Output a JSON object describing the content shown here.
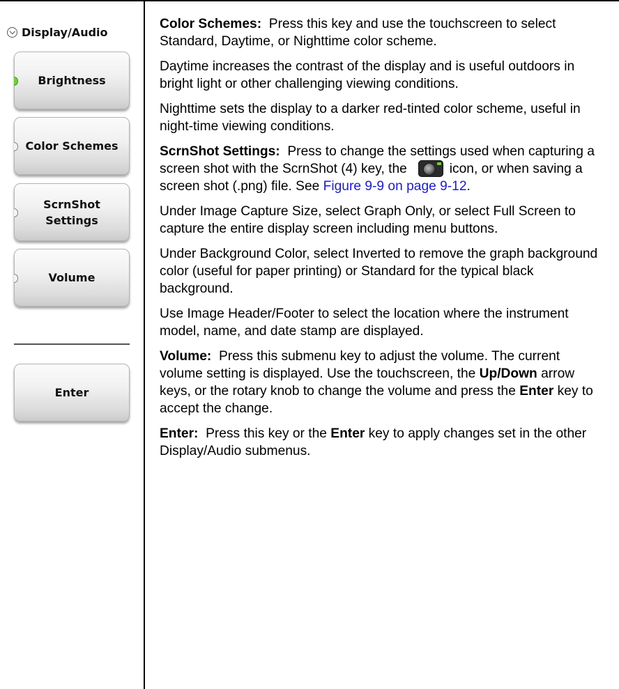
{
  "menu": {
    "title": "Display/Audio",
    "buttons": [
      {
        "label": "Brightness",
        "active": true
      },
      {
        "label": "Color Schemes",
        "active": false
      },
      {
        "label": "ScrnShot Settings",
        "active": false
      },
      {
        "label": "Volume",
        "active": false
      }
    ],
    "enter_label": "Enter"
  },
  "content": {
    "p1_term": "Color Schemes:",
    "p1_text": "Press this key and use the touchscreen to select Standard, Daytime, or Nighttime color scheme.",
    "p2": "Daytime increases the contrast of the display and is useful outdoors in bright light or other challenging viewing conditions.",
    "p3": "Nighttime sets the display to a darker red-tinted color scheme, useful in night-time viewing conditions.",
    "p4_term": "ScrnShot Settings:",
    "p4_text_a": "Press to change the settings used when capturing a screen shot with the ScrnShot (4) key, the",
    "p4_text_b": "icon, or when saving a screen shot (.png) file. See",
    "p4_link": "Figure 9-9 on page 9-12",
    "p4_end": ".",
    "p5": "Under Image Capture Size, select Graph Only, or select Full Screen to capture the entire display screen including menu buttons.",
    "p6": "Under Background Color, select Inverted to remove the graph background color (useful for paper printing) or Standard for the typical black background.",
    "p7": "Use Image Header/Footer to select the location where the instrument model, name, and date stamp are displayed.",
    "p8_term": "Volume:",
    "p8_text_a": "Press this submenu key to adjust the volume. The current volume setting is displayed. Use the touchscreen, the",
    "p8_bold_a": "Up/Down",
    "p8_text_b": "arrow keys, or the rotary knob to change the volume and press the",
    "p8_bold_b": "Enter",
    "p8_text_c": "key to accept the change.",
    "p9_term": "Enter:",
    "p9_text_a": "Press this key or the",
    "p9_bold": "Enter",
    "p9_text_b": "key to apply changes set in the other Display/Audio submenus."
  },
  "colors": {
    "link": "#1a1aee",
    "led_active": "#6fd12f"
  },
  "icons": [
    "chevron-down-circle-icon",
    "camera-icon"
  ]
}
